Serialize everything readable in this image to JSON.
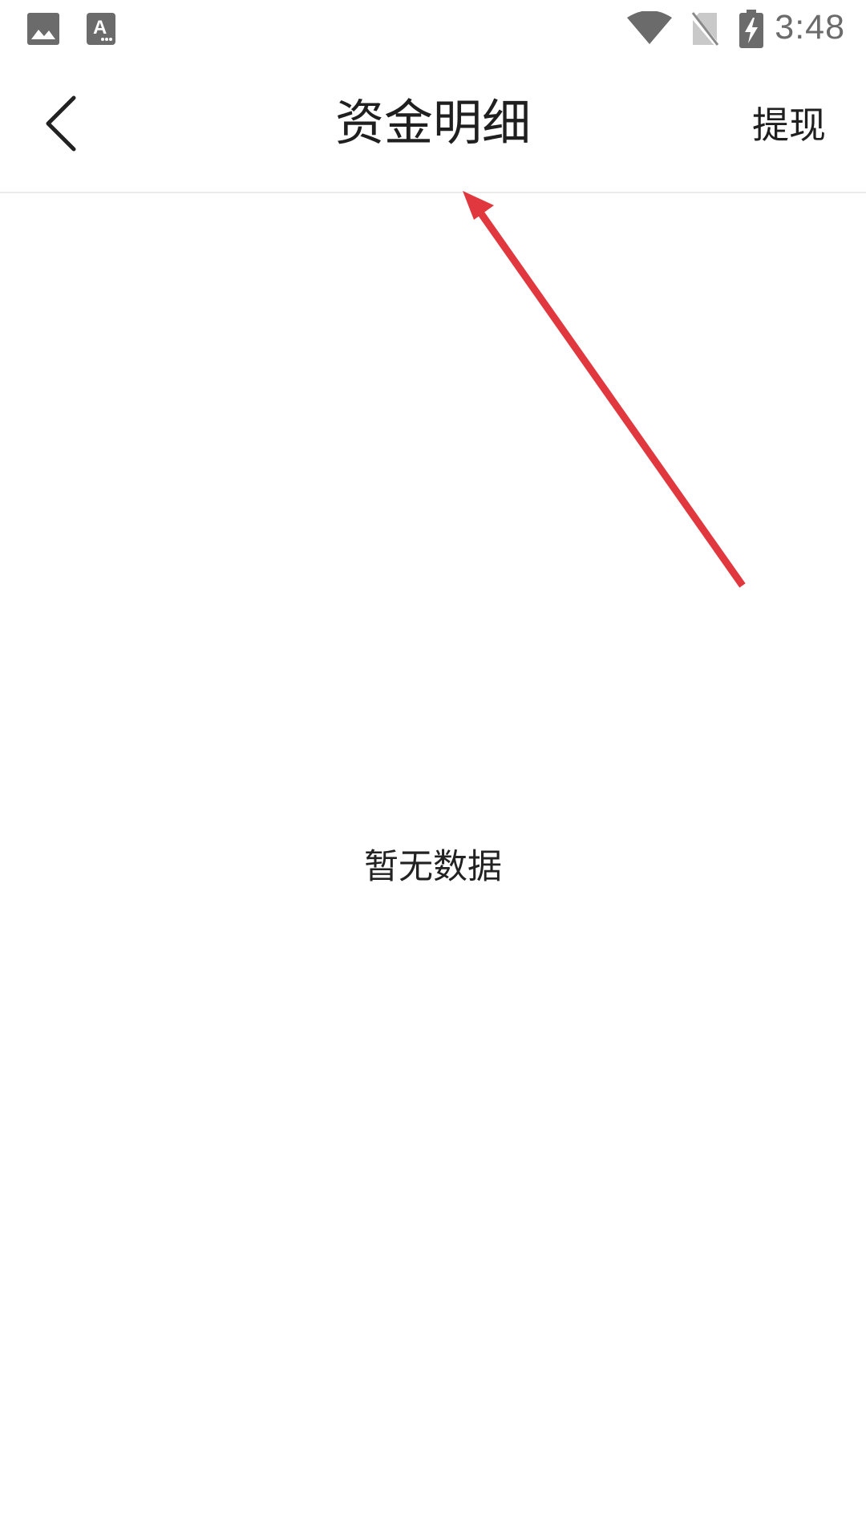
{
  "status_bar": {
    "time": "3:48",
    "icons": [
      "image-icon",
      "text-a-icon",
      "wifi-icon",
      "no-sim-icon",
      "battery-charging-icon"
    ]
  },
  "toolbar": {
    "title": "资金明细",
    "withdraw_label": "提现",
    "back_icon": "chevron-left-icon"
  },
  "content": {
    "empty_message": "暂无数据"
  },
  "colors": {
    "annotation_arrow": "#e0383e",
    "icon_gray": "#6b6b6b",
    "divider": "#ececec"
  }
}
